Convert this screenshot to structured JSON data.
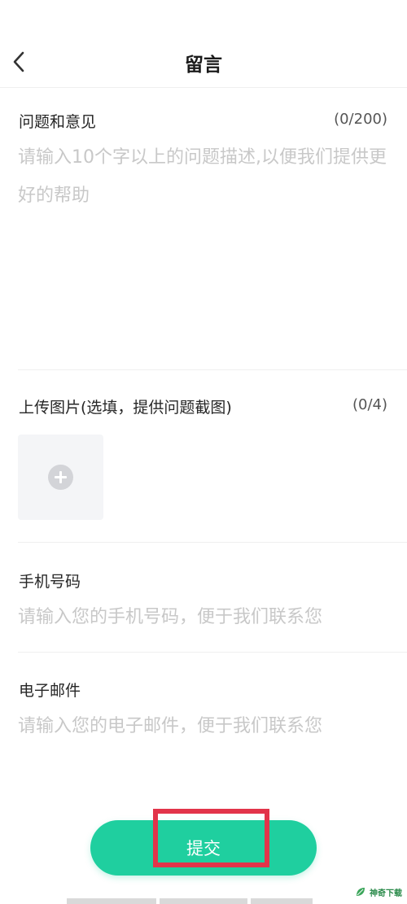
{
  "header": {
    "back_icon": "chevron-left-icon",
    "title": "留言"
  },
  "feedback": {
    "label": "问题和意见",
    "counter": "(0/200)",
    "placeholder": "请输入10个字以上的问题描述,以便我们提供更好的帮助",
    "value": ""
  },
  "upload": {
    "label": "上传图片(选填，提供问题截图)",
    "counter": "(0/4)",
    "add_icon": "plus-circle-icon"
  },
  "phone": {
    "label": "手机号码",
    "placeholder": "请输入您的手机号码，便于我们联系您",
    "value": ""
  },
  "email": {
    "label": "电子邮件",
    "placeholder": "请输入您的电子邮件，便于我们联系您",
    "value": ""
  },
  "submit": {
    "label": "提交"
  },
  "watermark": {
    "text": "神奇下载"
  },
  "colors": {
    "accent": "#1fcf9f",
    "highlight": "#e2344a",
    "placeholder": "#c8c8c8"
  }
}
